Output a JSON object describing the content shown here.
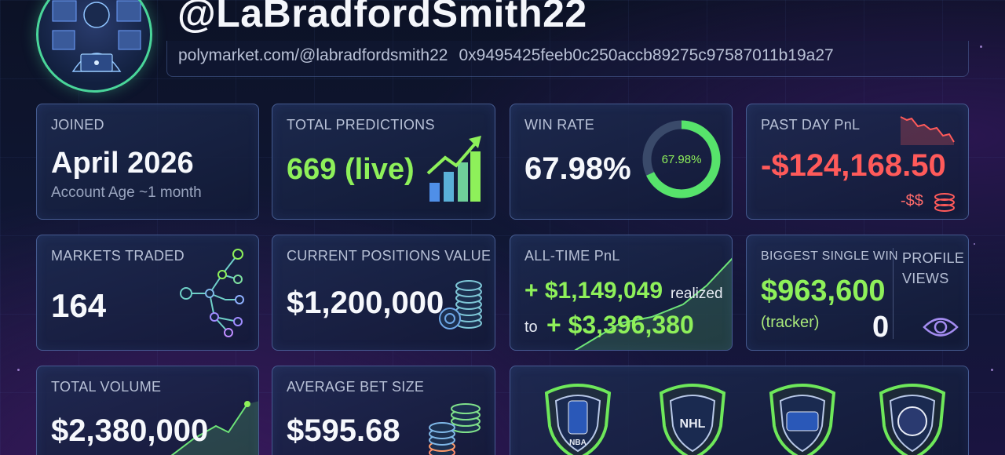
{
  "profile": {
    "handle": "@LaBradfordSmith22",
    "url": "polymarket.com/@labradfordsmith22",
    "wallet": "0x9495425feeb0c250accb89275c97587011b19a27"
  },
  "cards": {
    "joined": {
      "label": "JOINED",
      "value": "April 2026",
      "sub": "Account Age ~1 month"
    },
    "total_predictions": {
      "label": "TOTAL PREDICTIONS",
      "value": "669 (live)"
    },
    "win_rate": {
      "label": "WIN RATE",
      "value": "67.98%",
      "ring_label": "67.98%",
      "ring_fraction": 0.6798
    },
    "past_day_pnl": {
      "label": "PAST DAY PnL",
      "value": "-$124,168.50",
      "tag": "-$$"
    },
    "markets_traded": {
      "label": "MARKETS TRADED",
      "value": "164"
    },
    "current_positions": {
      "label": "CURRENT POSITIONS VALUE",
      "value": "$1,200,000"
    },
    "all_time_pnl": {
      "label": "ALL-TIME PnL",
      "line1_value": "+ $1,149,049",
      "line1_suffix": "realized",
      "line2_prefix": "to",
      "line2_value": "+ $3,396,380"
    },
    "biggest_win": {
      "label": "BIGGEST SINGLE WIN",
      "value": "$963,600",
      "sub": "(tracker)"
    },
    "profile_views": {
      "label": "PROFILE VIEWS",
      "value": "0"
    },
    "total_volume": {
      "label": "TOTAL VOLUME",
      "value": "$2,380,000"
    },
    "average_bet": {
      "label": "AVERAGE BET SIZE",
      "value": "$595.68"
    }
  },
  "leagues": [
    {
      "name": "nba-badge-icon",
      "text": "NBA"
    },
    {
      "name": "nhl-badge-icon",
      "text": "NHL"
    },
    {
      "name": "mlb-badge-icon",
      "text": ""
    },
    {
      "name": "soccer-ball-badge-icon",
      "text": ""
    }
  ],
  "colors": {
    "accent_green": "#8ef05a",
    "loss_red": "#ff5a5a",
    "border": "#6e8cd2",
    "ring_green": "#57e36b"
  }
}
